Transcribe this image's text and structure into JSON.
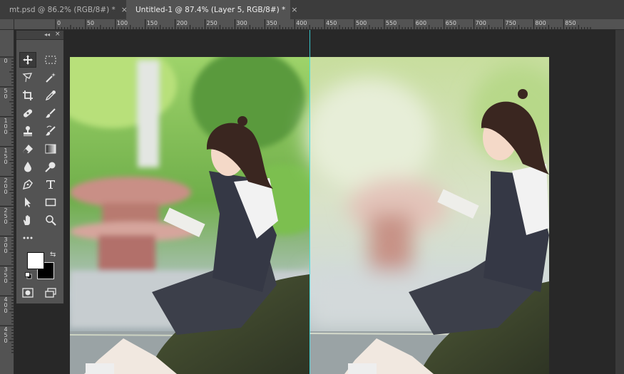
{
  "tabs": [
    {
      "label": "mt.psd @ 86.2% (RGB/8#) *",
      "close": "×",
      "active": false
    },
    {
      "label": "Untitled-1 @ 87.4% (Layer 5, RGB/8#) *",
      "close": "×",
      "active": true
    }
  ],
  "rulers": {
    "horizontal_labels": [
      "0",
      "50",
      "100",
      "150",
      "200",
      "250",
      "300",
      "350",
      "400",
      "450",
      "500",
      "550",
      "600",
      "650",
      "700",
      "750",
      "800",
      "850"
    ],
    "vertical_labels": [
      "0",
      "5 0",
      "1 0 0",
      "1 5 0",
      "2 0 0",
      "2 5 0",
      "3 0 0",
      "3 5 0",
      "4 0 0",
      "4 5 0"
    ]
  },
  "toolbar": {
    "grip": "◂◂",
    "close": "×",
    "tools": [
      {
        "name": "move-tool",
        "icon": "move-icon",
        "selected": true
      },
      {
        "name": "marquee-tool",
        "icon": "rect-marquee-icon",
        "selected": false
      },
      {
        "name": "lasso-tool",
        "icon": "polygon-lasso-icon",
        "selected": false
      },
      {
        "name": "magic-wand-tool",
        "icon": "magic-wand-icon",
        "selected": false
      },
      {
        "name": "crop-tool",
        "icon": "crop-icon",
        "selected": false
      },
      {
        "name": "eyedropper-tool",
        "icon": "eyedropper-icon",
        "selected": false
      },
      {
        "name": "healing-brush-tool",
        "icon": "bandage-icon",
        "selected": false
      },
      {
        "name": "brush-tool",
        "icon": "brush-icon",
        "selected": false
      },
      {
        "name": "clone-stamp-tool",
        "icon": "stamp-icon",
        "selected": false
      },
      {
        "name": "history-brush-tool",
        "icon": "history-brush-icon",
        "selected": false
      },
      {
        "name": "eraser-tool",
        "icon": "eraser-icon",
        "selected": false
      },
      {
        "name": "gradient-tool",
        "icon": "gradient-icon",
        "selected": false
      },
      {
        "name": "blur-tool",
        "icon": "drop-icon",
        "selected": false
      },
      {
        "name": "dodge-tool",
        "icon": "dodge-icon",
        "selected": false
      },
      {
        "name": "pen-tool",
        "icon": "pen-icon",
        "selected": false
      },
      {
        "name": "type-tool",
        "icon": "type-icon",
        "selected": false
      },
      {
        "name": "path-selection-tool",
        "icon": "arrow-icon",
        "selected": false
      },
      {
        "name": "shape-tool",
        "icon": "rectangle-icon",
        "selected": false
      },
      {
        "name": "hand-tool",
        "icon": "hand-icon",
        "selected": false
      },
      {
        "name": "zoom-tool",
        "icon": "zoom-icon",
        "selected": false
      },
      {
        "name": "edit-toolbar",
        "icon": "more-icon",
        "selected": false
      }
    ],
    "foreground_color": "#ffffff",
    "background_color": "#000000",
    "swap_icon": "⇆"
  },
  "colors": {
    "app_bg": "#282828",
    "panel_bg": "#535353",
    "guide": "#39e0e8"
  }
}
